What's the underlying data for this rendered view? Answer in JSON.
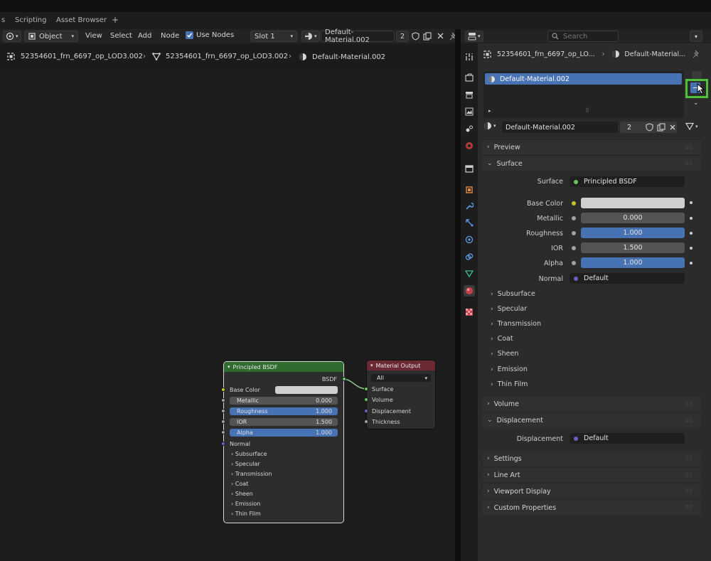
{
  "workspace_tabs": [
    "s",
    "Scripting",
    "Asset Browser",
    "+"
  ],
  "node_editor": {
    "header": {
      "object_mode": "Object",
      "menus": [
        "View",
        "Select",
        "Add",
        "Node"
      ],
      "use_nodes_label": "Use Nodes",
      "slot": "Slot 1",
      "material_name": "Default-Material.002",
      "user_count": "2"
    },
    "breadcrumb": [
      "52354601_frn_6697_op_LOD3.002",
      "52354601_frn_6697_op_LOD3.002",
      "Default-Material.002"
    ],
    "bsdf_node": {
      "title": "Principled BSDF",
      "output": "BSDF",
      "base_color_label": "Base Color",
      "fields": [
        {
          "label": "Metallic",
          "value": "0.000"
        },
        {
          "label": "Roughness",
          "value": "1.000"
        },
        {
          "label": "IOR",
          "value": "1.500"
        },
        {
          "label": "Alpha",
          "value": "1.000"
        }
      ],
      "normal_label": "Normal",
      "panels": [
        "Subsurface",
        "Specular",
        "Transmission",
        "Coat",
        "Sheen",
        "Emission",
        "Thin Film"
      ]
    },
    "output_node": {
      "title": "Material Output",
      "target": "All",
      "inputs": [
        "Surface",
        "Volume",
        "Displacement",
        "Thickness"
      ]
    }
  },
  "properties": {
    "search_placeholder": "Search",
    "breadcrumb": [
      "52354601_frn_6697_op_LO...",
      "Default-Material..."
    ],
    "slot_list_item": "Default-Material.002",
    "material_name": "Default-Material.002",
    "user_count": "2",
    "sections": {
      "preview": "Preview",
      "surface": "Surface",
      "volume": "Volume",
      "displacement": "Displacement",
      "settings": "Settings",
      "line_art": "Line Art",
      "viewport_display": "Viewport Display",
      "custom_properties": "Custom Properties"
    },
    "surface_label": "Surface",
    "surface_shader": "Principled BSDF",
    "base_color_label": "Base Color",
    "fields": [
      {
        "label": "Metallic",
        "value": "0.000"
      },
      {
        "label": "Roughness",
        "value": "1.000"
      },
      {
        "label": "IOR",
        "value": "1.500"
      },
      {
        "label": "Alpha",
        "value": "1.000"
      }
    ],
    "normal_label": "Normal",
    "normal_value": "Default",
    "subpanels": [
      "Subsurface",
      "Specular",
      "Transmission",
      "Coat",
      "Sheen",
      "Emission",
      "Thin Film"
    ],
    "displacement_label": "Displacement",
    "displacement_value": "Default"
  },
  "colors": {
    "accent_blue": "#4772b3",
    "highlight_green": "#4fc13a",
    "bsdf_header": "#2f6b2f",
    "output_header": "#6b2a33",
    "socket_yellow": "#c7c729",
    "socket_grey": "#a1a1a1",
    "socket_purple": "#6363c7",
    "socket_green": "#63c763"
  }
}
